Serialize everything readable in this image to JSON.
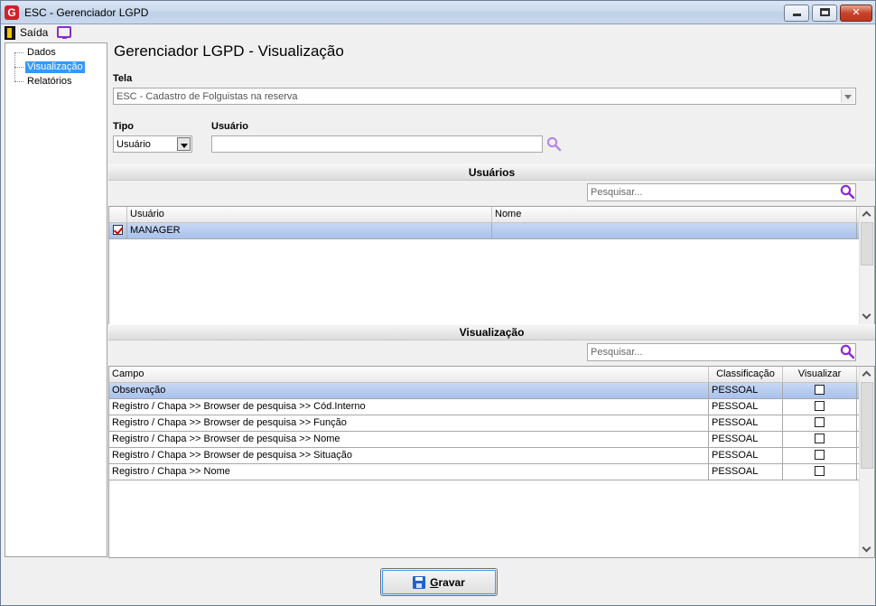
{
  "window": {
    "app_icon_letter": "G",
    "title": "ESC - Gerenciador LGPD",
    "close_glyph": "✕"
  },
  "toolbar": {
    "exit_label": "Saída"
  },
  "tree": {
    "items": [
      {
        "label": "Dados",
        "selected": false
      },
      {
        "label": "Visualização",
        "selected": true
      },
      {
        "label": "Relatórios",
        "selected": false
      }
    ]
  },
  "main": {
    "title": "Gerenciador LGPD - Visualização",
    "tela_label": "Tela",
    "tela_value": "ESC - Cadastro de Folguistas na reserva",
    "tipo_label": "Tipo",
    "tipo_value": "Usuário",
    "usuario_label": "Usuário",
    "usuario_value": ""
  },
  "usuarios_section": {
    "header": "Usuários",
    "search_placeholder": "Pesquisar...",
    "columns": [
      "Usuário",
      "Nome"
    ],
    "rows": [
      {
        "checked": true,
        "usuario": "MANAGER",
        "nome": "",
        "selected": true
      }
    ]
  },
  "visualizacao_section": {
    "header": "Visualização",
    "search_placeholder": "Pesquisar...",
    "columns": [
      "Campo",
      "Classificação",
      "Visualizar"
    ],
    "rows": [
      {
        "campo": "Observação",
        "classificacao": "PESSOAL",
        "visualizar": false,
        "selected": true
      },
      {
        "campo": "Registro / Chapa >> Browser de pesquisa >> Cód.Interno",
        "classificacao": "PESSOAL",
        "visualizar": false,
        "selected": false
      },
      {
        "campo": "Registro / Chapa >> Browser de pesquisa >> Função",
        "classificacao": "PESSOAL",
        "visualizar": false,
        "selected": false
      },
      {
        "campo": "Registro / Chapa >> Browser de pesquisa >> Nome",
        "classificacao": "PESSOAL",
        "visualizar": false,
        "selected": false
      },
      {
        "campo": "Registro / Chapa >> Browser de pesquisa >> Situação",
        "classificacao": "PESSOAL",
        "visualizar": false,
        "selected": false
      },
      {
        "campo": "Registro / Chapa >> Nome",
        "classificacao": "PESSOAL",
        "visualizar": false,
        "selected": false
      }
    ]
  },
  "footer": {
    "save_label_first": "G",
    "save_label_rest": "ravar"
  },
  "colors": {
    "selection_blue": "#3399ff",
    "row_selected": "#b9cdf0",
    "search_icon": "#8a2bd6",
    "close_red": "#c7432a"
  }
}
